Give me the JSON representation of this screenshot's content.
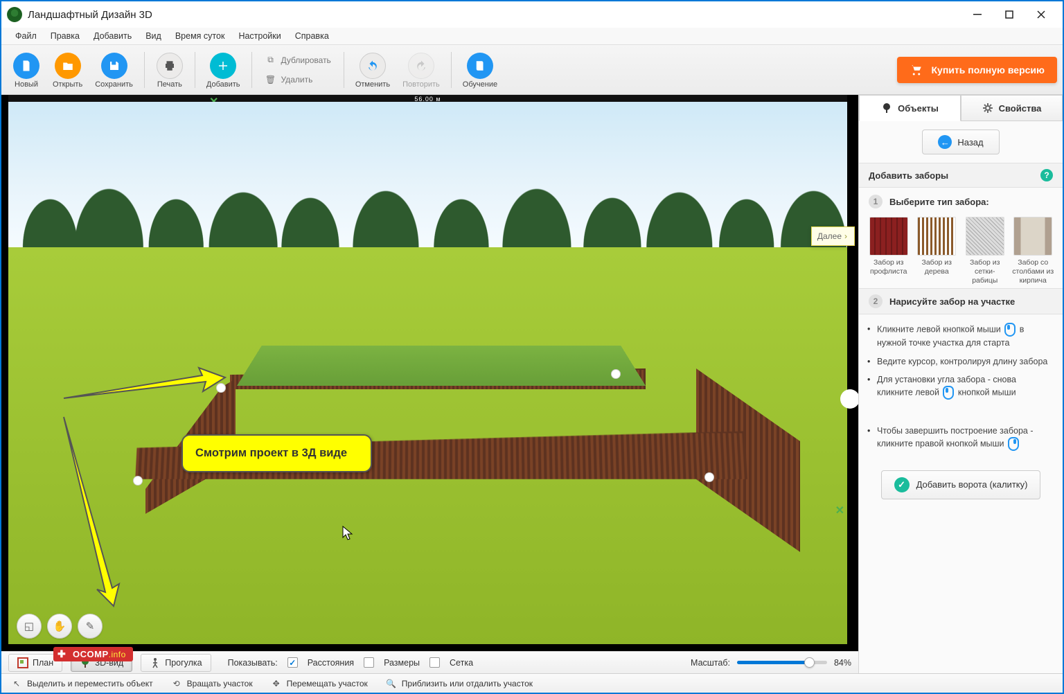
{
  "title": "Ландшафтный Дизайн 3D",
  "menu": [
    "Файл",
    "Правка",
    "Добавить",
    "Вид",
    "Время суток",
    "Настройки",
    "Справка"
  ],
  "toolbar": {
    "new": "Новый",
    "open": "Открыть",
    "save": "Сохранить",
    "print": "Печать",
    "add": "Добавить",
    "duplicate": "Дублировать",
    "delete": "Удалить",
    "undo": "Отменить",
    "redo": "Повторить",
    "tutorial": "Обучение",
    "buy": "Купить полную версию"
  },
  "viewport": {
    "ruler_top": "56.00 м",
    "next": "Далее",
    "callout": "Смотрим проект в 3Д виде"
  },
  "viewbar": {
    "plan": "План",
    "v3d": "3D-вид",
    "walk": "Прогулка",
    "show": "Показывать:",
    "dist": "Расстояния",
    "size": "Размеры",
    "grid": "Сетка",
    "scale_label": "Масштаб:",
    "scale_value": "84%"
  },
  "sidepanel": {
    "tab_objects": "Объекты",
    "tab_props": "Свойства",
    "back": "Назад",
    "add_fences": "Добавить заборы",
    "step1": "Выберите тип забора:",
    "fences": [
      {
        "label": "Забор из профлиста"
      },
      {
        "label": "Забор из дерева"
      },
      {
        "label": "Забор из сетки-рабицы"
      },
      {
        "label": "Забор со столбами из кирпича"
      }
    ],
    "step2": "Нарисуйте забор на участке",
    "instr1a": "Кликните левой кнопкой мыши",
    "instr1b": "в нужной точке участка для старта",
    "instr2": "Ведите курсор, контролируя длину забора",
    "instr3a": "Для установки угла забора - снова кликните левой",
    "instr3b": "кнопкой мыши",
    "instr4a": "Чтобы завершить построение забора - кликните правой кнопкой мыши",
    "add_gate": "Добавить ворота (калитку)"
  },
  "statusbar": {
    "select": "Выделить и переместить объект",
    "rotate": "Вращать участок",
    "move": "Перемещать участок",
    "zoom": "Приблизить или отдалить участок"
  },
  "watermark": {
    "brand": "OCOMP",
    "suffix": ".info"
  }
}
